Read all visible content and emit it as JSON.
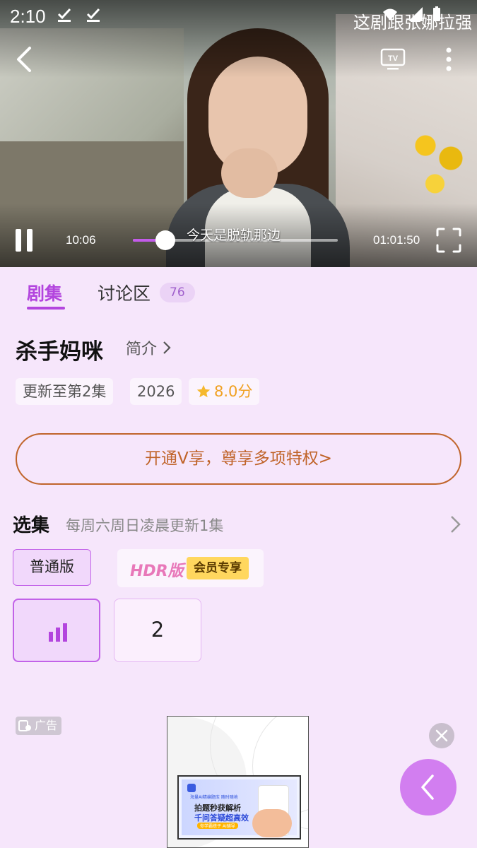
{
  "status_bar": {
    "time": "2:10",
    "marquee": "这剧跟张娜拉强"
  },
  "player": {
    "current_time": "10:06",
    "total_time": "01:01:50",
    "progress": 0.16,
    "subtitle": "今天是脱轨那边"
  },
  "tabs": [
    {
      "label": "剧集",
      "active": true
    },
    {
      "label": "讨论区",
      "badge": "76"
    }
  ],
  "show": {
    "title": "杀手妈咪",
    "intro_label": "简介",
    "tags": [
      "更新至第2集",
      "2026"
    ],
    "rating": "8.0分"
  },
  "vip_banner": "开通V享，尊享多项特权>",
  "episodes_section": {
    "title": "选集",
    "subtitle": "每周六周日凌晨更新1集",
    "versions": {
      "normal": "普通版",
      "hdr": "HDR版",
      "hdr_badge": "会员专享"
    },
    "episodes": [
      "1",
      "2"
    ],
    "playing_episode": 1
  },
  "ad": {
    "label": "广告",
    "line1": "海量AI精编题库 随时随地",
    "line2": "拍题秒获解析",
    "line3": "千问答疑超高效",
    "line4": "你学霸搭子 AI辅导"
  },
  "colors": {
    "accent": "#b345de",
    "vip": "#c0642a",
    "rating": "#f0a020",
    "background": "#f6e6fb"
  }
}
